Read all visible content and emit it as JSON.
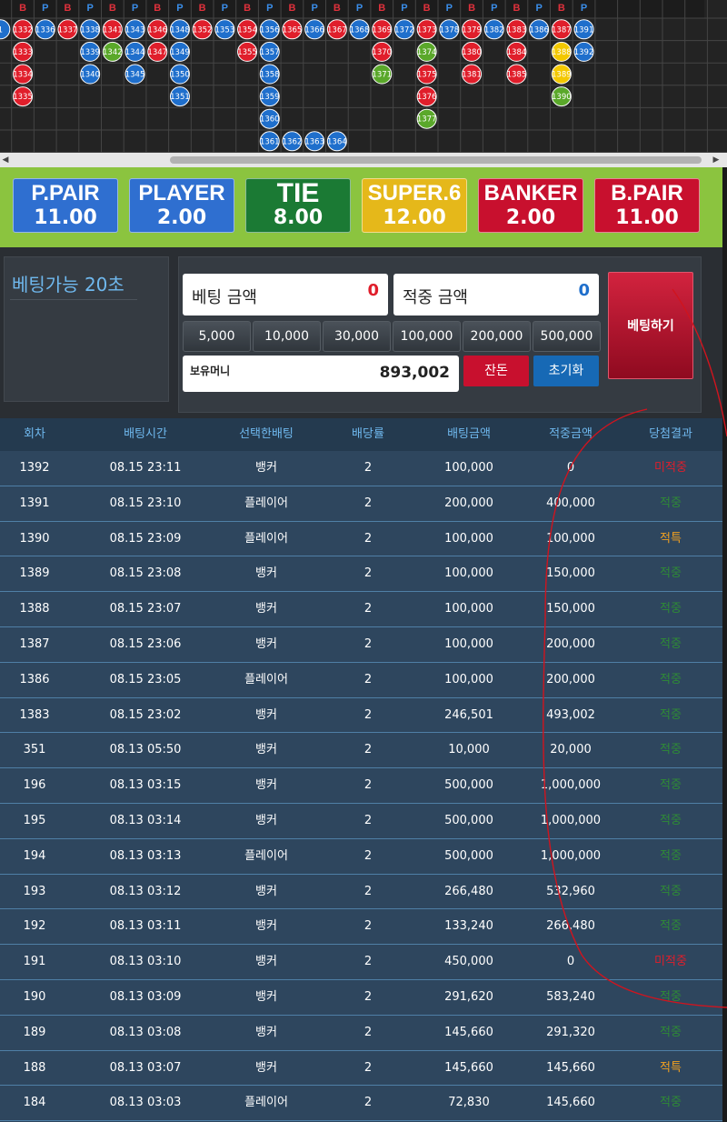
{
  "road": {
    "header_letters": [
      "B",
      "P",
      "B",
      "P",
      "B",
      "P",
      "B",
      "P",
      "B",
      "P",
      "B",
      "P",
      "B",
      "P",
      "B",
      "P",
      "B",
      "P",
      "B",
      "P",
      "B",
      "P",
      "B",
      "P",
      "B",
      "P"
    ],
    "columns": [
      [
        {
          "n": "1",
          "c": "blue"
        }
      ],
      [
        {
          "n": "1332",
          "c": "red"
        },
        {
          "n": "1333",
          "c": "red"
        },
        {
          "n": "1334",
          "c": "red"
        },
        {
          "n": "1335",
          "c": "red"
        }
      ],
      [
        {
          "n": "1336",
          "c": "blue"
        }
      ],
      [
        {
          "n": "1337",
          "c": "red"
        }
      ],
      [
        {
          "n": "1338",
          "c": "blue"
        },
        {
          "n": "1339",
          "c": "blue"
        },
        {
          "n": "1340",
          "c": "blue"
        }
      ],
      [
        {
          "n": "1341",
          "c": "red"
        },
        {
          "n": "1342",
          "c": "green"
        }
      ],
      [
        {
          "n": "1343",
          "c": "blue"
        },
        {
          "n": "1344",
          "c": "blue"
        },
        {
          "n": "1345",
          "c": "blue"
        }
      ],
      [
        {
          "n": "1346",
          "c": "red"
        },
        {
          "n": "1347",
          "c": "red"
        }
      ],
      [
        {
          "n": "1348",
          "c": "blue"
        },
        {
          "n": "1349",
          "c": "blue"
        },
        {
          "n": "1350",
          "c": "blue"
        },
        {
          "n": "1351",
          "c": "blue"
        }
      ],
      [
        {
          "n": "1352",
          "c": "red"
        }
      ],
      [
        {
          "n": "1353",
          "c": "blue"
        }
      ],
      [
        {
          "n": "1354",
          "c": "red"
        },
        {
          "n": "1355",
          "c": "red"
        }
      ],
      [
        {
          "n": "1356",
          "c": "blue"
        },
        {
          "n": "1357",
          "c": "blue"
        },
        {
          "n": "1358",
          "c": "blue"
        },
        {
          "n": "1359",
          "c": "blue"
        },
        {
          "n": "1360",
          "c": "blue"
        },
        {
          "n": "1361",
          "c": "blue"
        }
      ],
      [
        {
          "n": "1365",
          "c": "red"
        },
        null,
        null,
        null,
        null,
        {
          "n": "1362",
          "c": "blue"
        }
      ],
      [
        {
          "n": "1366",
          "c": "blue"
        },
        null,
        null,
        null,
        null,
        {
          "n": "1363",
          "c": "blue"
        }
      ],
      [
        {
          "n": "1367",
          "c": "red"
        },
        null,
        null,
        null,
        null,
        {
          "n": "1364",
          "c": "blue"
        }
      ],
      [
        {
          "n": "1368",
          "c": "blue"
        }
      ],
      [
        {
          "n": "1369",
          "c": "red"
        },
        {
          "n": "1370",
          "c": "red"
        },
        {
          "n": "1371",
          "c": "green"
        }
      ],
      [
        {
          "n": "1372",
          "c": "blue"
        }
      ],
      [
        {
          "n": "1373",
          "c": "red"
        },
        {
          "n": "1374",
          "c": "green"
        },
        {
          "n": "1375",
          "c": "red"
        },
        {
          "n": "1376",
          "c": "red"
        },
        {
          "n": "1377",
          "c": "green"
        }
      ],
      [
        {
          "n": "1378",
          "c": "blue"
        }
      ],
      [
        {
          "n": "1379",
          "c": "red"
        },
        {
          "n": "1380",
          "c": "red"
        },
        {
          "n": "1381",
          "c": "red"
        }
      ],
      [
        {
          "n": "1382",
          "c": "blue"
        }
      ],
      [
        {
          "n": "1383",
          "c": "red"
        },
        {
          "n": "1384",
          "c": "red"
        },
        {
          "n": "1385",
          "c": "red"
        }
      ],
      [
        {
          "n": "1386",
          "c": "blue"
        }
      ],
      [
        {
          "n": "1387",
          "c": "red"
        },
        {
          "n": "1388",
          "c": "yellow"
        },
        {
          "n": "1389",
          "c": "yellow"
        },
        {
          "n": "1390",
          "c": "green"
        }
      ],
      [
        {
          "n": "1391",
          "c": "blue"
        },
        {
          "n": "1392",
          "c": "blue"
        }
      ]
    ],
    "ball_colors": {
      "red": "#e01e2b",
      "blue": "#1f6fcc",
      "green": "#5aa82a",
      "yellow": "#f3c800"
    },
    "letter_colors": {
      "B": "#e0313c",
      "P": "#3a8de8"
    }
  },
  "bets": [
    {
      "name": "P.PAIR",
      "odds": "11.00",
      "color": "#2f6fd0"
    },
    {
      "name": "PLAYER",
      "odds": "2.00",
      "color": "#2f6fd0"
    },
    {
      "name": "TIE",
      "odds": "8.00",
      "color": "#1b7a34"
    },
    {
      "name": "SUPER.6",
      "odds": "12.00",
      "color": "#e5b81a"
    },
    {
      "name": "BANKER",
      "odds": "2.00",
      "color": "#c8102e"
    },
    {
      "name": "B.PAIR",
      "odds": "11.00",
      "color": "#c8102e"
    }
  ],
  "panel": {
    "timer": "베팅가능 20초",
    "bet_amount_label": "베팅 금액",
    "bet_amount_value": "0",
    "win_amount_label": "적중 금액",
    "win_amount_value": "0",
    "chips": [
      "5,000",
      "10,000",
      "30,000",
      "100,000",
      "200,000",
      "500,000"
    ],
    "money_label": "보유머니",
    "money_value": "893,002",
    "change_label": "잔돈",
    "reset_label": "초기화",
    "place_label": "베팅하기",
    "colors": {
      "bet_value": "#e01e2b",
      "win_value": "#1f6fcc"
    }
  },
  "history": {
    "headers": [
      "회차",
      "배팅시간",
      "선택한배팅",
      "배당률",
      "배팅금액",
      "적중금액",
      "당첨결과"
    ],
    "rows": [
      [
        "1392",
        "08.15 23:11",
        "뱅커",
        "2",
        "100,000",
        "0",
        "미적중"
      ],
      [
        "1391",
        "08.15 23:10",
        "플레이어",
        "2",
        "200,000",
        "400,000",
        "적중"
      ],
      [
        "1390",
        "08.15 23:09",
        "플레이어",
        "2",
        "100,000",
        "100,000",
        "적특"
      ],
      [
        "1389",
        "08.15 23:08",
        "뱅커",
        "2",
        "100,000",
        "150,000",
        "적중"
      ],
      [
        "1388",
        "08.15 23:07",
        "뱅커",
        "2",
        "100,000",
        "150,000",
        "적중"
      ],
      [
        "1387",
        "08.15 23:06",
        "뱅커",
        "2",
        "100,000",
        "200,000",
        "적중"
      ],
      [
        "1386",
        "08.15 23:05",
        "플레이어",
        "2",
        "100,000",
        "200,000",
        "적중"
      ],
      [
        "1383",
        "08.15 23:02",
        "뱅커",
        "2",
        "246,501",
        "493,002",
        "적중"
      ],
      [
        "351",
        "08.13 05:50",
        "뱅커",
        "2",
        "10,000",
        "20,000",
        "적중"
      ],
      [
        "196",
        "08.13 03:15",
        "뱅커",
        "2",
        "500,000",
        "1,000,000",
        "적중"
      ],
      [
        "195",
        "08.13 03:14",
        "뱅커",
        "2",
        "500,000",
        "1,000,000",
        "적중"
      ],
      [
        "194",
        "08.13 03:13",
        "플레이어",
        "2",
        "500,000",
        "1,000,000",
        "적중"
      ],
      [
        "193",
        "08.13 03:12",
        "뱅커",
        "2",
        "266,480",
        "532,960",
        "적중"
      ],
      [
        "192",
        "08.13 03:11",
        "뱅커",
        "2",
        "133,240",
        "266,480",
        "적중"
      ],
      [
        "191",
        "08.13 03:10",
        "뱅커",
        "2",
        "450,000",
        "0",
        "미적중"
      ],
      [
        "190",
        "08.13 03:09",
        "뱅커",
        "2",
        "291,620",
        "583,240",
        "적중"
      ],
      [
        "189",
        "08.13 03:08",
        "뱅커",
        "2",
        "145,660",
        "291,320",
        "적중"
      ],
      [
        "188",
        "08.13 03:07",
        "뱅커",
        "2",
        "145,660",
        "145,660",
        "적특"
      ],
      [
        "184",
        "08.13 03:03",
        "플레이어",
        "2",
        "72,830",
        "145,660",
        "적중"
      ]
    ],
    "result_colors": {
      "미적중": "#e01e2b",
      "적중": "#2e8a36",
      "적특": "#f0a020"
    }
  }
}
